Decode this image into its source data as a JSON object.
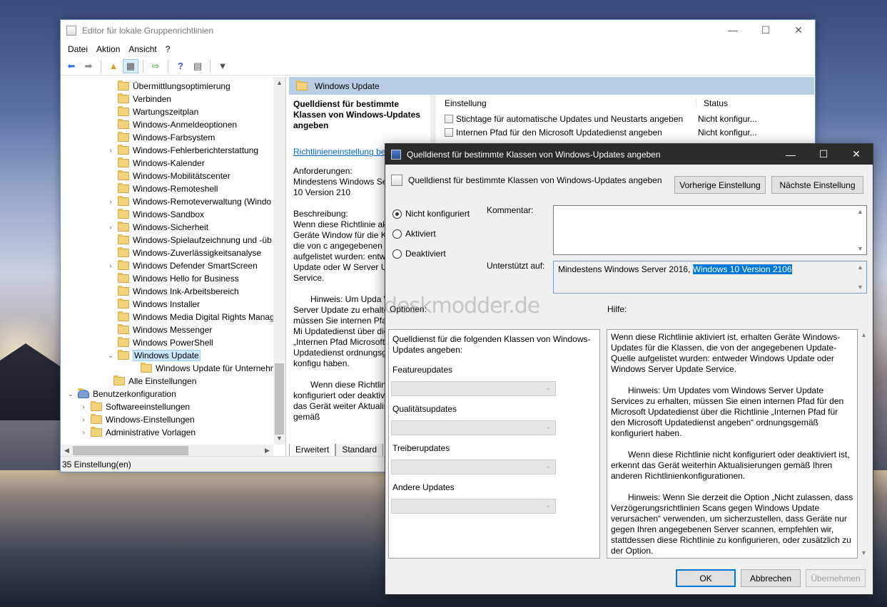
{
  "main": {
    "title": "Editor für lokale Gruppenrichtlinien",
    "menu": [
      "Datei",
      "Aktion",
      "Ansicht",
      "?"
    ],
    "tree": [
      {
        "label": "Übermittlungsoptimierung",
        "expandable": false
      },
      {
        "label": "Verbinden",
        "expandable": false
      },
      {
        "label": "Wartungszeitplan",
        "expandable": false
      },
      {
        "label": "Windows-Anmeldeoptionen",
        "expandable": false
      },
      {
        "label": "Windows-Farbsystem",
        "expandable": false
      },
      {
        "label": "Windows-Fehlerberichterstattung",
        "expandable": true
      },
      {
        "label": "Windows-Kalender",
        "expandable": false
      },
      {
        "label": "Windows-Mobilitätscenter",
        "expandable": false
      },
      {
        "label": "Windows-Remoteshell",
        "expandable": false
      },
      {
        "label": "Windows-Remoteverwaltung (Windo",
        "expandable": true
      },
      {
        "label": "Windows-Sandbox",
        "expandable": false
      },
      {
        "label": "Windows-Sicherheit",
        "expandable": true
      },
      {
        "label": "Windows-Spielaufzeichnung und -üb",
        "expandable": false
      },
      {
        "label": "Windows-Zuverlässigkeitsanalyse",
        "expandable": false
      },
      {
        "label": "Windows Defender SmartScreen",
        "expandable": true
      },
      {
        "label": "Windows Hello for Business",
        "expandable": false
      },
      {
        "label": "Windows Ink-Arbeitsbereich",
        "expandable": false
      },
      {
        "label": "Windows Installer",
        "expandable": false
      },
      {
        "label": "Windows Media Digital Rights Manag",
        "expandable": false
      },
      {
        "label": "Windows Messenger",
        "expandable": false
      },
      {
        "label": "Windows PowerShell",
        "expandable": false
      },
      {
        "label": "Windows Update",
        "expandable": true,
        "expanded": true,
        "selected": true
      },
      {
        "label": "Windows Update für Unternehme",
        "expandable": false,
        "child": true
      },
      {
        "label": "Alle Einstellungen",
        "expandable": false,
        "special": true
      },
      {
        "label": "Benutzerkonfiguration",
        "expandable": true,
        "expanded": true,
        "root": true
      },
      {
        "label": "Softwareeinstellungen",
        "expandable": true
      },
      {
        "label": "Windows-Einstellungen",
        "expandable": true
      },
      {
        "label": "Administrative Vorlagen",
        "expandable": true
      }
    ],
    "detail_header": "Windows Update",
    "desc": {
      "title": "Quelldienst für bestimmte Klassen von Windows-Updates angeben",
      "edit_link": "Richtlinieneinstellung bearbeiten",
      "req_label": "Anforderungen:",
      "req_text": "Mindestens Windows Se Windows 10 Version 210",
      "desc_label": "Beschreibung:",
      "p1": "Wenn diese Richtlinie ak erhalten Geräte Window für die Klassen, die von c angegebenen Update-Q aufgelistet wurden: entw Windows Update oder W Server Update Service.",
      "p2": "Hinweis: Um Upda Windows Server Update zu erhalten, müssen Sie internen Pfad für den Mi Updatedienst über die Richtlinie „Internen Pfad Microsoft Updatedienst ordnungsgemäß konfigu haben.",
      "p3": "Wenn diese Richtlin konfiguriert oder deaktiv erkennt das Gerät weiter Aktualisierungen gemäß"
    },
    "tabs": [
      "Erweitert",
      "Standard"
    ],
    "list": {
      "col_setting": "Einstellung",
      "col_status": "Status",
      "rows": [
        {
          "name": "Stichtage für automatische Updates und Neustarts angeben",
          "status": "Nicht konfigur..."
        },
        {
          "name": "Internen Pfad für den Microsoft Updatedienst angeben",
          "status": "Nicht konfigur..."
        }
      ]
    },
    "status": "35 Einstellung(en)"
  },
  "dialog": {
    "title": "Quelldienst für bestimmte Klassen von Windows-Updates angeben",
    "heading": "Quelldienst für bestimmte Klassen von Windows-Updates angeben",
    "prev_btn": "Vorherige Einstellung",
    "next_btn": "Nächste Einstellung",
    "radio_not": "Nicht konfiguriert",
    "radio_on": "Aktiviert",
    "radio_off": "Deaktiviert",
    "comment_label": "Kommentar:",
    "supported_label": "Unterstützt auf:",
    "supported_text_1": "Mindestens Windows Server 2016, ",
    "supported_text_2": "Windows 10 Version 2106",
    "options_label": "Optionen:",
    "help_label": "Hilfe:",
    "options_title": "Quelldienst für die folgenden Klassen von Windows-Updates angeben:",
    "opt_feature": "Featureupdates",
    "opt_quality": "Qualitätsupdates",
    "opt_driver": "Treiberupdates",
    "opt_other": "Andere Updates",
    "help_p1": "Wenn diese Richtlinie aktiviert ist, erhalten Geräte Windows-Updates für die Klassen, die von der angegebenen Update-Quelle aufgelistet wurden: entweder Windows Update oder Windows Server Update Service.",
    "help_p2": "Hinweis: Um Updates vom Windows Server Update Services zu erhalten, müssen Sie einen internen Pfad für den Microsoft Updatedienst über die Richtlinie „Internen Pfad für den Microsoft Updatedienst angeben“ ordnungsgemäß konfiguriert haben.",
    "help_p3": "Wenn diese Richtlinie nicht konfiguriert oder deaktiviert ist, erkennt das Gerät weiterhin Aktualisierungen gemäß Ihren anderen Richtlinienkonfigurationen.",
    "help_p4": "Hinweis: Wenn Sie derzeit die Option „Nicht zulassen, dass Verzögerungsrichtlinien Scans gegen Windows Update verursachen“ verwenden, um sicherzustellen, dass Geräte nur gegen Ihren angegebenen Server scannen, empfehlen wir, stattdessen diese Richtlinie zu konfigurieren, oder zusätzlich zu der Option.",
    "ok": "OK",
    "cancel": "Abbrechen",
    "apply": "Übernehmen"
  },
  "watermark": "deskmodder.de"
}
